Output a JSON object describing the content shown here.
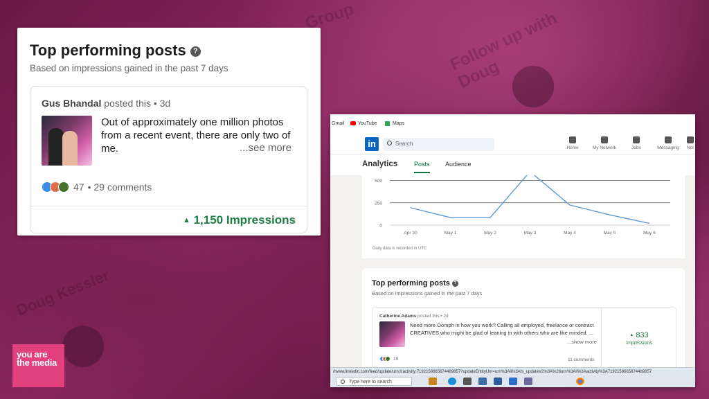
{
  "left_card": {
    "title": "Top performing posts",
    "help_glyph": "?",
    "subtitle": "Based on impressions gained in the past 7 days",
    "post": {
      "author": "Gus Bhandal",
      "posted": "posted this • 3d",
      "text": "Out of approximately one million photos from a recent event, there are only two of me.",
      "see_more": "...see more",
      "reactions": "47",
      "comments": "• 29 comments",
      "impressions": "1,150 Impressions"
    }
  },
  "logo_text": "you are the media",
  "linkedin_window": {
    "bookmarks": [
      "Gmail",
      "YouTube",
      "Maps"
    ],
    "logo": "in",
    "search_placeholder": "Search",
    "nav_items": [
      "Home",
      "My Network",
      "Jobs",
      "Messaging",
      "Not"
    ],
    "analytics_label": "Analytics",
    "tabs": [
      "Posts",
      "Audience"
    ],
    "active_tab": "Posts",
    "daily_note": "Daily data is recorded in UTC",
    "top_posts": {
      "title": "Top performing posts",
      "help_glyph": "?",
      "subtitle": "Based on impressions gained in the past 7 days",
      "post": {
        "author": "Catherine Adams",
        "posted": "posted this • 2d",
        "text": "Need more Oomph in how you work? Calling all employed, freelance or contract CREATIVES who might be glad of leaning in with others who are like minded. ...",
        "see_more": "...show more",
        "impressions_value": "833",
        "impressions_label": "Impressions",
        "reactions": "19",
        "comments": "11 comments"
      }
    },
    "status_url": "//www.linkedin.com/feed/update/urn:li:activity:7192158665674489857?updateEntityUrn=urn%3Ali%3Afs_updateV2%3A%28urn%3Ali%3Aactivity%3A7192158665674489857",
    "taskbar_search": "Type here to search"
  },
  "chart_data": {
    "type": "line",
    "categories": [
      "Apr 30",
      "May 1",
      "May 2",
      "May 3",
      "May 4",
      "May 5",
      "May 6"
    ],
    "values": [
      195,
      85,
      85,
      600,
      225,
      115,
      20
    ],
    "y_ticks": [
      0,
      250,
      500
    ],
    "ylim": [
      0,
      520
    ],
    "line_color": "#5b9bd5",
    "grid": true
  },
  "colors": {
    "impressions_green": "#1e7d44",
    "linkedin_blue": "#0a66c2",
    "logo_pink": "#e3407e"
  }
}
